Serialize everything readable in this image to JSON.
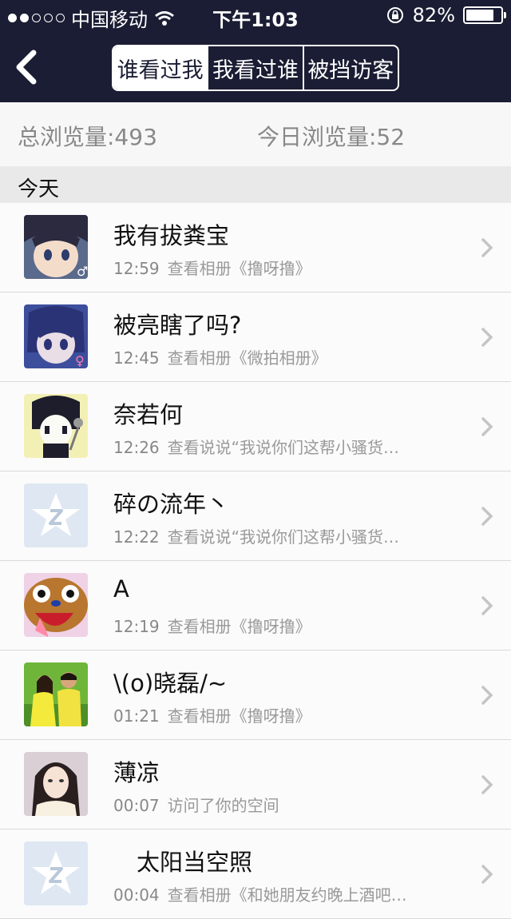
{
  "status_bar": {
    "carrier": "中国移动",
    "time": "下午1:03",
    "battery": "82%",
    "battery_level": 0.82,
    "signal_bars_filled": 2,
    "signal_bars_total": 5
  },
  "nav": {
    "tabs": [
      {
        "label": "谁看过我",
        "active": true
      },
      {
        "label": "我看过谁",
        "active": false
      },
      {
        "label": "被挡访客",
        "active": false
      }
    ]
  },
  "stats": {
    "total": "总浏览量:493",
    "today": "今日浏览量:52"
  },
  "section_label": "今天",
  "visitors": [
    {
      "name": "我有拔粪宝",
      "time": "12:59",
      "action": "查看相册《撸呀撸》",
      "avatar": "anime-boy-avatar"
    },
    {
      "name": "被亮瞎了吗?",
      "time": "12:45",
      "action": "查看相册《微拍相册》",
      "avatar": "anime-girl-avatar"
    },
    {
      "name": "奈若何",
      "time": "12:26",
      "action": "查看说说“我说你们这帮小骚货…",
      "avatar": "cartoon-singer-avatar"
    },
    {
      "name": "碎の流年丶",
      "time": "12:22",
      "action": "查看说说“我说你们这帮小骚货…",
      "avatar": "default-qzone-avatar"
    },
    {
      "name": "A",
      "time": "12:19",
      "action": "查看相册《撸呀撸》",
      "avatar": "chopper-avatar"
    },
    {
      "name": "\\(o)晓磊/~",
      "time": "01:21",
      "action": "查看相册《撸呀撸》",
      "avatar": "couple-photo-avatar"
    },
    {
      "name": "薄凉",
      "time": "00:07",
      "action": "访问了你的空间",
      "avatar": "woman-photo-avatar"
    },
    {
      "name": "　太阳当空照",
      "time": "00:04",
      "action": "查看相册《和她朋友约晚上酒吧…",
      "avatar": "default-qzone-avatar"
    }
  ],
  "colors": {
    "nav_bg": "#1a1d33",
    "accent": "#ffffff"
  }
}
